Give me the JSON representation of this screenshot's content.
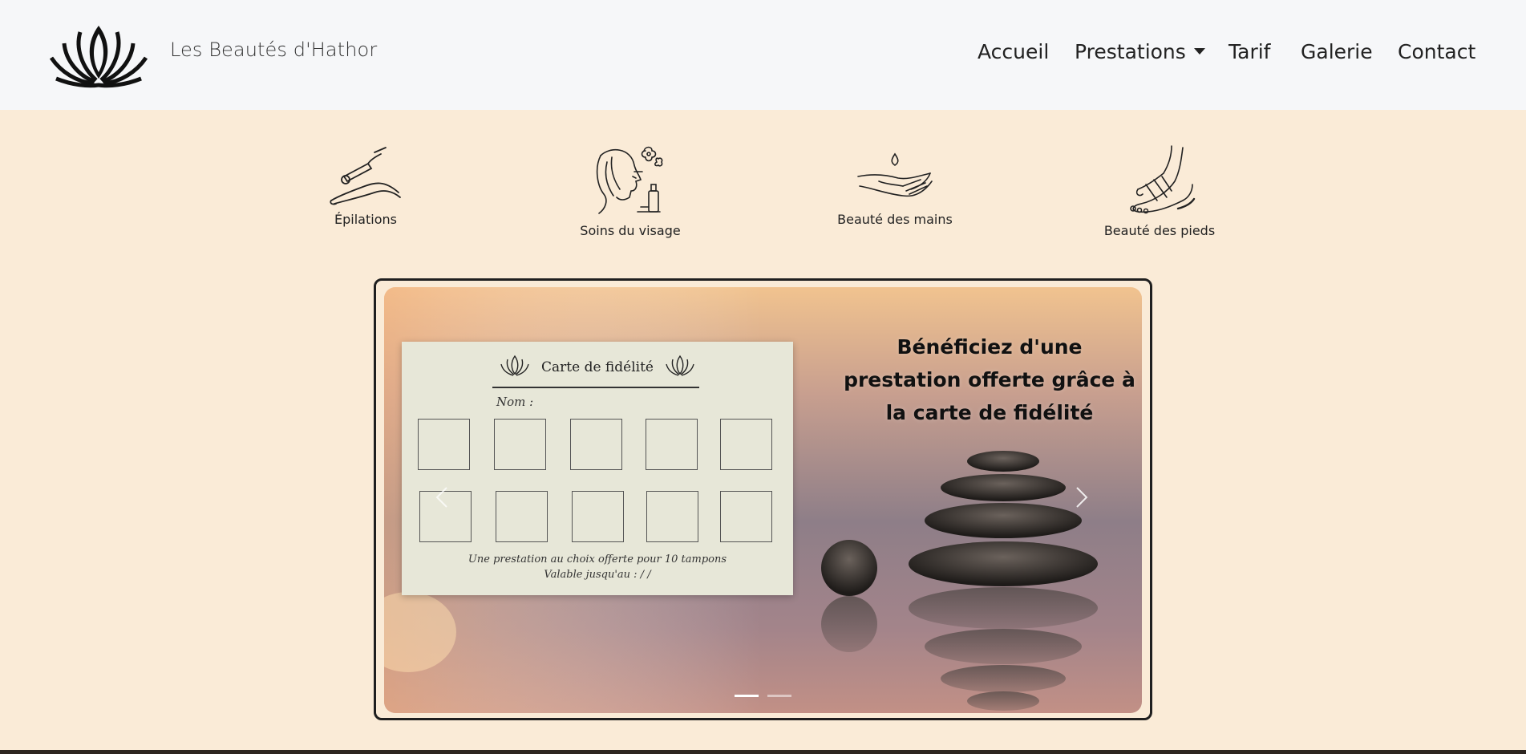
{
  "navbar": {
    "brand": "Les Beautés d'Hathor",
    "links": {
      "accueil": "Accueil",
      "prestations": "Prestations",
      "tarif": "Tarif",
      "galerie": "Galerie",
      "contact": "Contact"
    }
  },
  "services": [
    {
      "label": "Épilations",
      "icon": "leg-waxing-icon"
    },
    {
      "label": "Soins du visage",
      "icon": "face-care-icon"
    },
    {
      "label": "Beauté des mains",
      "icon": "hands-icon"
    },
    {
      "label": "Beauté des pieds",
      "icon": "feet-icon"
    }
  ],
  "carousel": {
    "caption": "Bénéficiez d'une prestation offerte grâce à la carte de fidélité",
    "card": {
      "title": "Carte de fidélité",
      "name_label": "Nom :",
      "footer_line1": "Une prestation au choix offerte pour 10 tampons",
      "footer_line2": "Valable jusqu'au :          /          /"
    },
    "slide_count": 2,
    "active_slide": 1
  },
  "colors": {
    "page_bg": "#faebd7",
    "navbar_bg": "#f6f7f9",
    "frame_border": "#1f1f1f"
  }
}
